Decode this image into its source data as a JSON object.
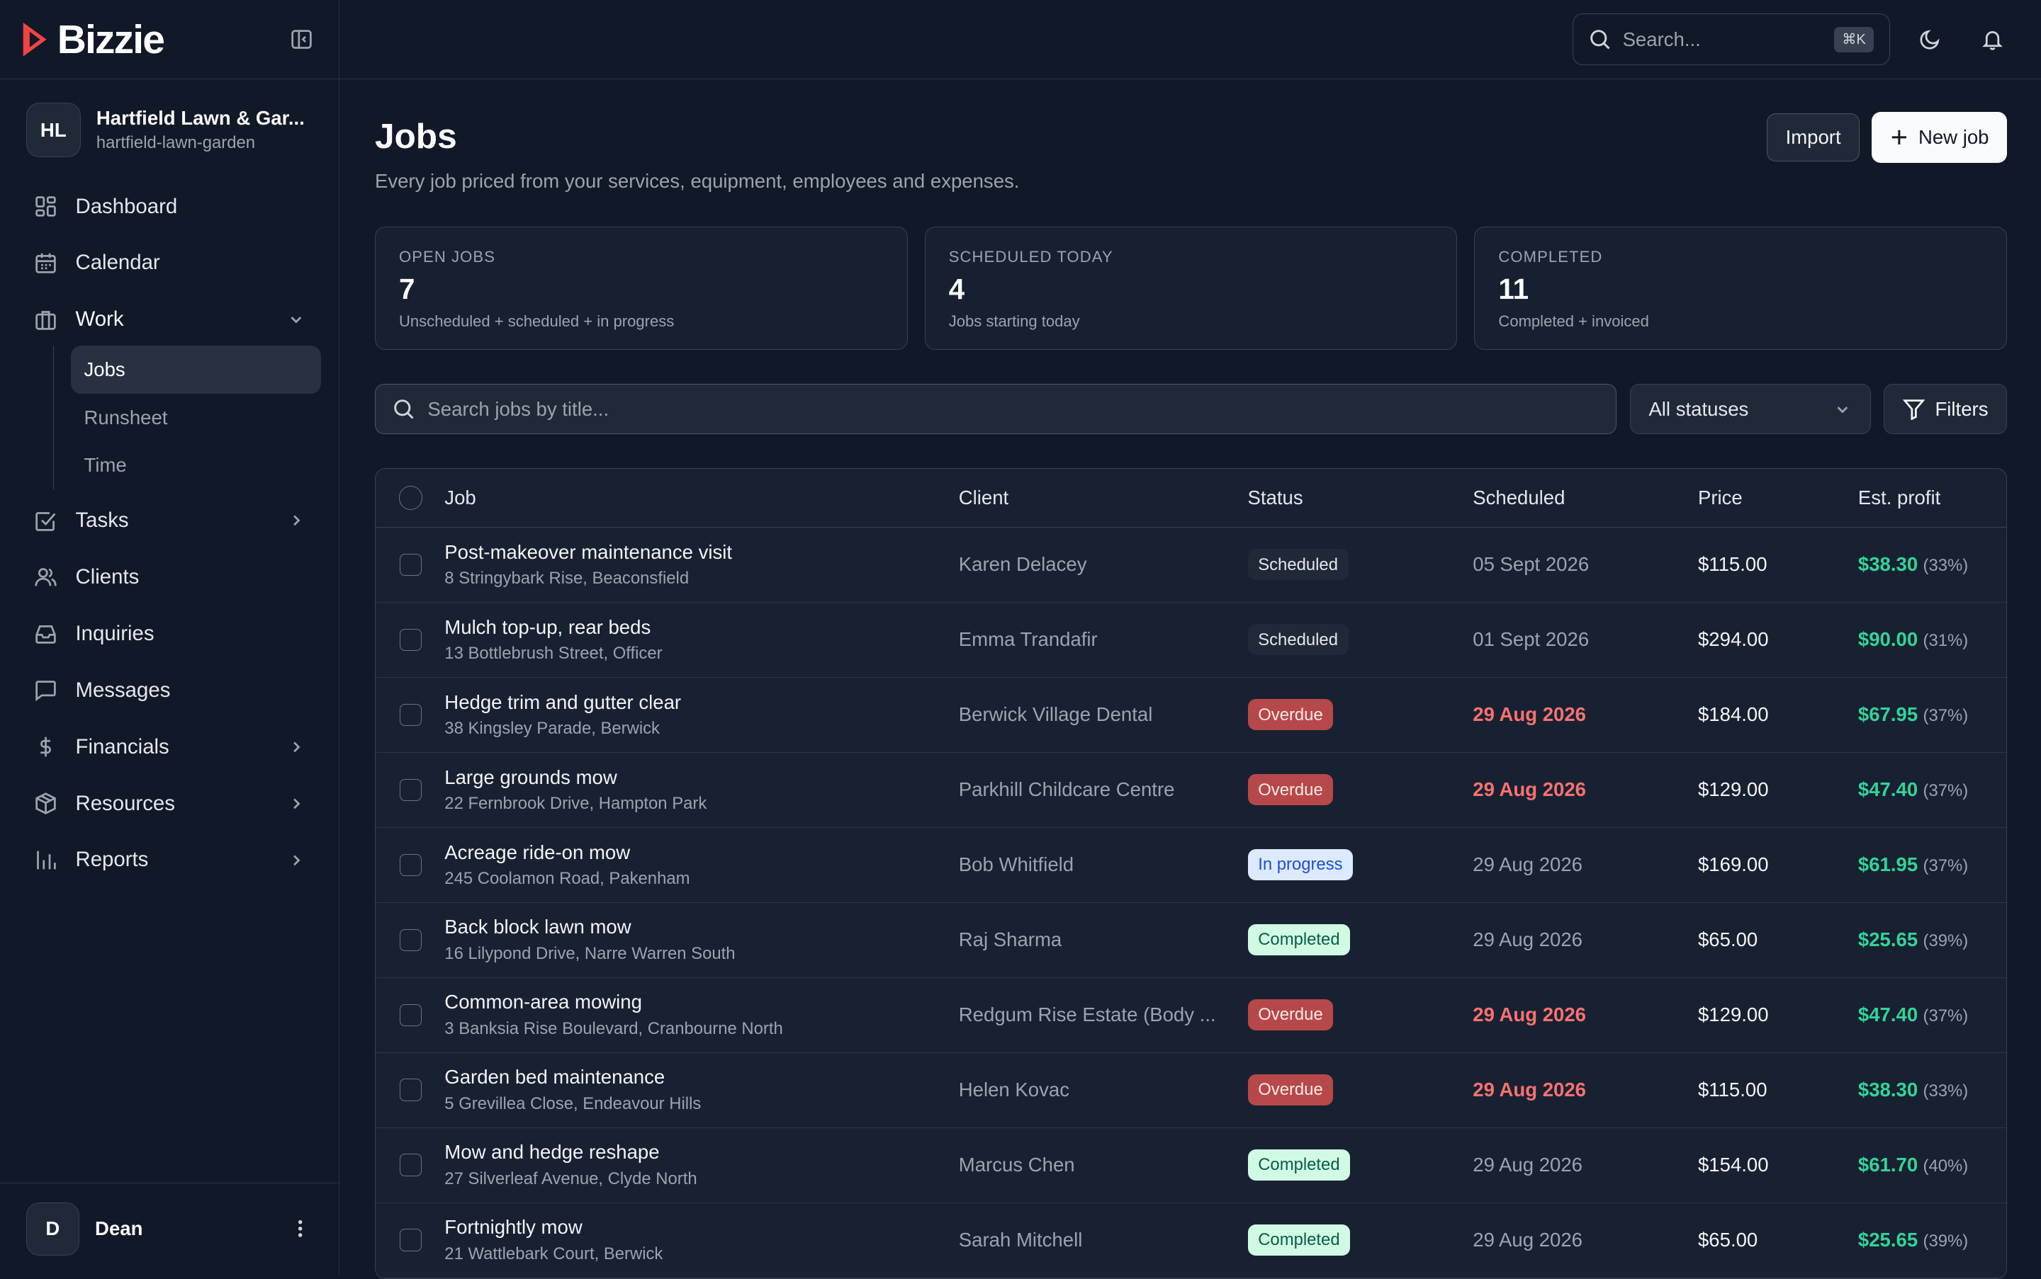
{
  "brand": {
    "name": "Bizzie",
    "accent": "#ef4444"
  },
  "org": {
    "initials": "HL",
    "name": "Hartfield Lawn & Gar...",
    "slug": "hartfield-lawn-garden"
  },
  "nav": {
    "dashboard": "Dashboard",
    "calendar": "Calendar",
    "work": "Work",
    "jobs": "Jobs",
    "runsheet": "Runsheet",
    "time": "Time",
    "tasks": "Tasks",
    "clients": "Clients",
    "inquiries": "Inquiries",
    "messages": "Messages",
    "financials": "Financials",
    "resources": "Resources",
    "reports": "Reports"
  },
  "user": {
    "initial": "D",
    "name": "Dean"
  },
  "topbar": {
    "search_placeholder": "Search...",
    "shortcut": "⌘K"
  },
  "page": {
    "title": "Jobs",
    "subtitle": "Every job priced from your services, equipment, employees and expenses.",
    "import_label": "Import",
    "new_job_label": "New job"
  },
  "stats": [
    {
      "label": "OPEN JOBS",
      "value": "7",
      "desc": "Unscheduled + scheduled + in progress"
    },
    {
      "label": "SCHEDULED TODAY",
      "value": "4",
      "desc": "Jobs starting today"
    },
    {
      "label": "COMPLETED",
      "value": "11",
      "desc": "Completed + invoiced"
    }
  ],
  "filters": {
    "search_placeholder": "Search jobs by title...",
    "status_value": "All statuses",
    "filters_label": "Filters"
  },
  "table": {
    "headers": {
      "job": "Job",
      "client": "Client",
      "status": "Status",
      "scheduled": "Scheduled",
      "price": "Price",
      "profit": "Est. profit"
    },
    "rows": [
      {
        "title": "Post-makeover maintenance visit",
        "address": "8 Stringybark Rise, Beaconsfield",
        "client": "Karen Delacey",
        "status": "Scheduled",
        "status_kind": "scheduled",
        "scheduled": "05 Sept 2026",
        "overdue": false,
        "price": "$115.00",
        "profit": "$38.30",
        "pct": "(33%)"
      },
      {
        "title": "Mulch top-up, rear beds",
        "address": "13 Bottlebrush Street, Officer",
        "client": "Emma Trandafir",
        "status": "Scheduled",
        "status_kind": "scheduled",
        "scheduled": "01 Sept 2026",
        "overdue": false,
        "price": "$294.00",
        "profit": "$90.00",
        "pct": "(31%)"
      },
      {
        "title": "Hedge trim and gutter clear",
        "address": "38 Kingsley Parade, Berwick",
        "client": "Berwick Village Dental",
        "status": "Overdue",
        "status_kind": "overdue",
        "scheduled": "29 Aug 2026",
        "overdue": true,
        "price": "$184.00",
        "profit": "$67.95",
        "pct": "(37%)"
      },
      {
        "title": "Large grounds mow",
        "address": "22 Fernbrook Drive, Hampton Park",
        "client": "Parkhill Childcare Centre",
        "status": "Overdue",
        "status_kind": "overdue",
        "scheduled": "29 Aug 2026",
        "overdue": true,
        "price": "$129.00",
        "profit": "$47.40",
        "pct": "(37%)"
      },
      {
        "title": "Acreage ride-on mow",
        "address": "245 Coolamon Road, Pakenham",
        "client": "Bob Whitfield",
        "status": "In progress",
        "status_kind": "progress",
        "scheduled": "29 Aug 2026",
        "overdue": false,
        "price": "$169.00",
        "profit": "$61.95",
        "pct": "(37%)"
      },
      {
        "title": "Back block lawn mow",
        "address": "16 Lilypond Drive, Narre Warren South",
        "client": "Raj Sharma",
        "status": "Completed",
        "status_kind": "completed",
        "scheduled": "29 Aug 2026",
        "overdue": false,
        "price": "$65.00",
        "profit": "$25.65",
        "pct": "(39%)"
      },
      {
        "title": "Common-area mowing",
        "address": "3 Banksia Rise Boulevard, Cranbourne North",
        "client": "Redgum Rise Estate (Body ...",
        "status": "Overdue",
        "status_kind": "overdue",
        "scheduled": "29 Aug 2026",
        "overdue": true,
        "price": "$129.00",
        "profit": "$47.40",
        "pct": "(37%)"
      },
      {
        "title": "Garden bed maintenance",
        "address": "5 Grevillea Close, Endeavour Hills",
        "client": "Helen Kovac",
        "status": "Overdue",
        "status_kind": "overdue",
        "scheduled": "29 Aug 2026",
        "overdue": true,
        "price": "$115.00",
        "profit": "$38.30",
        "pct": "(33%)"
      },
      {
        "title": "Mow and hedge reshape",
        "address": "27 Silverleaf Avenue, Clyde North",
        "client": "Marcus Chen",
        "status": "Completed",
        "status_kind": "completed",
        "scheduled": "29 Aug 2026",
        "overdue": false,
        "price": "$154.00",
        "profit": "$61.70",
        "pct": "(40%)"
      },
      {
        "title": "Fortnightly mow",
        "address": "21 Wattlebark Court, Berwick",
        "client": "Sarah Mitchell",
        "status": "Completed",
        "status_kind": "completed",
        "scheduled": "29 Aug 2026",
        "overdue": false,
        "price": "$65.00",
        "profit": "$25.65",
        "pct": "(39%)"
      }
    ]
  }
}
